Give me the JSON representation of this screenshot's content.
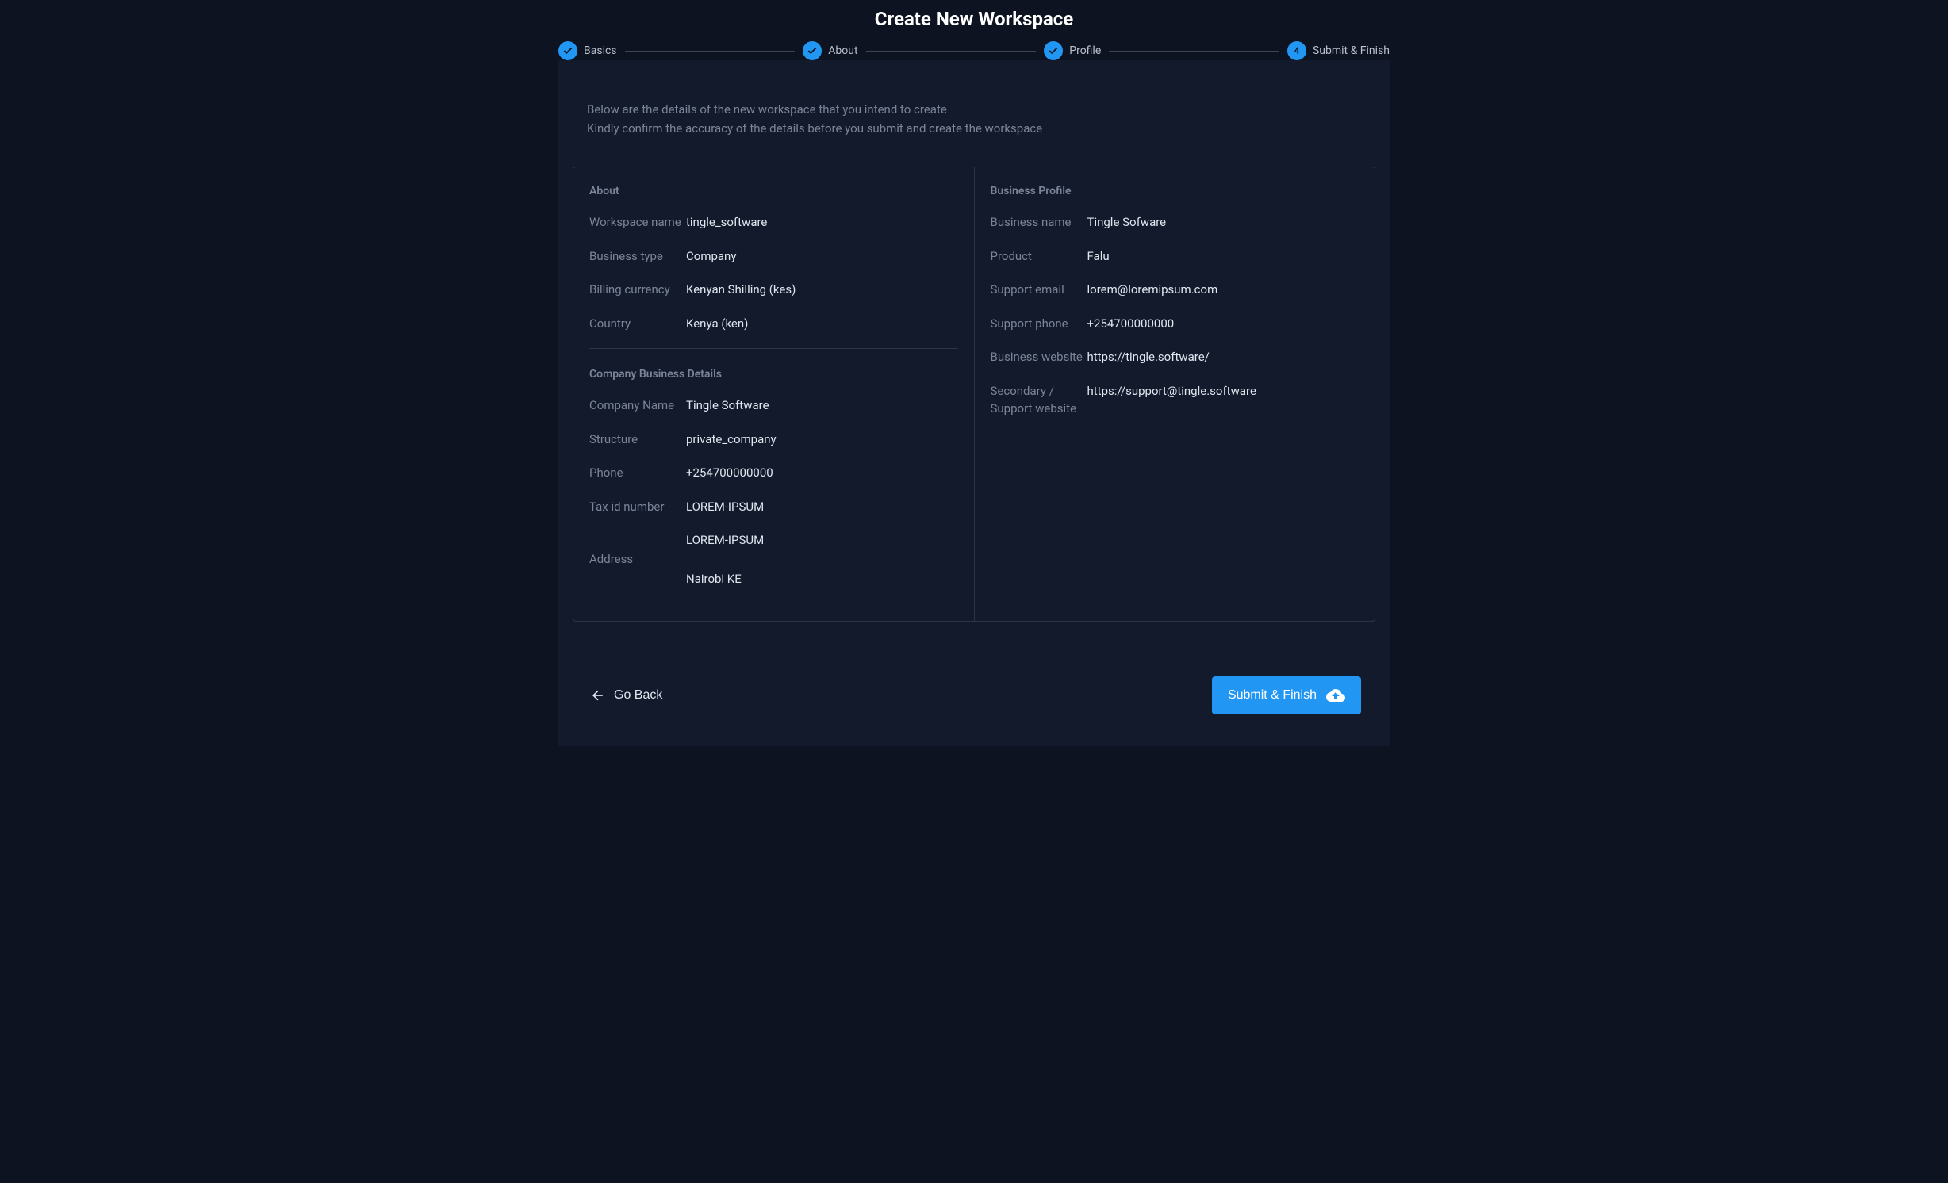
{
  "page_title": "Create New Workspace",
  "stepper": {
    "steps": [
      {
        "label": "Basics",
        "type": "check"
      },
      {
        "label": "About",
        "type": "check"
      },
      {
        "label": "Profile",
        "type": "check"
      },
      {
        "label": "Submit & Finish",
        "type": "number",
        "number": "4"
      }
    ]
  },
  "intro": {
    "line1": "Below are the details of the new workspace that you intend to create",
    "line2": "Kindly confirm the accuracy of the details before you submit and create the workspace"
  },
  "about": {
    "heading": "About",
    "fields": {
      "workspace_name": {
        "label": "Workspace name",
        "value": "tingle_software"
      },
      "business_type": {
        "label": "Business type",
        "value": "Company"
      },
      "billing_currency": {
        "label": "Billing currency",
        "value": "Kenyan Shilling (kes)"
      },
      "country": {
        "label": "Country",
        "value": "Kenya (ken)"
      }
    }
  },
  "company": {
    "heading": "Company Business Details",
    "fields": {
      "company_name": {
        "label": "Company Name",
        "value": "Tingle Software"
      },
      "structure": {
        "label": "Structure",
        "value": "private_company"
      },
      "phone": {
        "label": "Phone",
        "value": "+254700000000"
      },
      "tax_id": {
        "label": "Tax id number",
        "value": "LOREM-IPSUM"
      },
      "address": {
        "label": "Address",
        "line1": "LOREM-IPSUM",
        "line2": "Nairobi KE"
      }
    }
  },
  "profile": {
    "heading": "Business Profile",
    "fields": {
      "business_name": {
        "label": "Business name",
        "value": "Tingle Sofware"
      },
      "product": {
        "label": "Product",
        "value": "Falu"
      },
      "support_email": {
        "label": "Support email",
        "value": "lorem@loremipsum.com"
      },
      "support_phone": {
        "label": "Support phone",
        "value": "+254700000000"
      },
      "business_website": {
        "label": "Business website",
        "value": "https://tingle.software/"
      },
      "support_website": {
        "label": "Secondary / Support website",
        "value": "https://support@tingle.software"
      }
    }
  },
  "footer": {
    "back_label": "Go Back",
    "submit_label": "Submit & Finish"
  }
}
